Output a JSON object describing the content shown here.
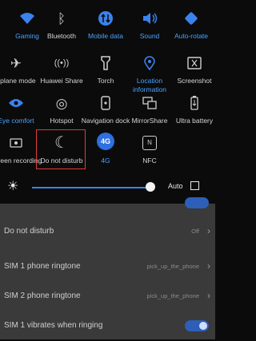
{
  "tiles": [
    {
      "label": "Gaming",
      "icon": "wifi-icon",
      "glyph": "📶",
      "state": "on"
    },
    {
      "label": "Bluetooth",
      "icon": "bluetooth-icon",
      "glyph": "ᛒ",
      "state": "off"
    },
    {
      "label": "Mobile data",
      "icon": "mobile-data-icon",
      "glyph": "⇅",
      "state": "on"
    },
    {
      "label": "Sound",
      "icon": "sound-icon",
      "glyph": "🔊",
      "state": "on"
    },
    {
      "label": "Auto-rotate",
      "icon": "auto-rotate-icon",
      "glyph": "⟳",
      "state": "on"
    },
    {
      "label": "irplane mode",
      "icon": "airplane-icon",
      "glyph": "✈",
      "state": "off"
    },
    {
      "label": "Huawei Share",
      "icon": "huawei-share-icon",
      "glyph": "((•))",
      "state": "off"
    },
    {
      "label": "Torch",
      "icon": "torch-icon",
      "glyph": "🔦",
      "state": "off"
    },
    {
      "label": "Location information",
      "icon": "location-icon",
      "glyph": "📍",
      "state": "on"
    },
    {
      "label": "Screenshot",
      "icon": "screenshot-icon",
      "glyph": "✂",
      "state": "off"
    },
    {
      "label": "Eye comfort",
      "icon": "eye-comfort-icon",
      "glyph": "👁",
      "state": "on"
    },
    {
      "label": "Hotspot",
      "icon": "hotspot-icon",
      "glyph": "◎",
      "state": "off"
    },
    {
      "label": "Navigation dock",
      "icon": "navigation-dock-icon",
      "glyph": "▣",
      "state": "off"
    },
    {
      "label": "MirrorShare",
      "icon": "mirrorshare-icon",
      "glyph": "⧉",
      "state": "off"
    },
    {
      "label": "Ultra battery",
      "icon": "ultra-battery-icon",
      "glyph": "▮",
      "state": "off"
    },
    {
      "label": "Screen recording",
      "icon": "screen-recording-icon",
      "glyph": "⏺",
      "state": "off"
    },
    {
      "label": "Do not disturb",
      "icon": "moon-icon",
      "glyph": "☾",
      "state": "off"
    },
    {
      "label": "4G",
      "icon": "4g-icon",
      "glyph": "4G",
      "state": "on"
    },
    {
      "label": "NFC",
      "icon": "nfc-icon",
      "glyph": "N",
      "state": "off"
    }
  ],
  "brightness": {
    "auto_label": "Auto",
    "level_percent": 84
  },
  "settings": [
    {
      "label": "Do not disturb",
      "value": "Off"
    },
    {
      "label": "SIM 1 phone ringtone",
      "value": "pick_up_the_phone"
    },
    {
      "label": "SIM 2 phone ringtone",
      "value": "pick_up_the_phone"
    },
    {
      "label": "SIM 1 vibrates when ringing",
      "value": ""
    }
  ]
}
